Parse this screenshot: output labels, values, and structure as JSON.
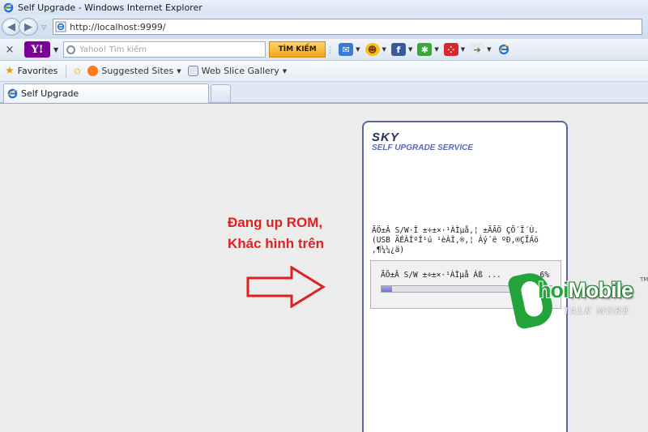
{
  "window": {
    "title": "Self Upgrade - Windows Internet Explorer"
  },
  "address_bar": {
    "url": "http://localhost:9999/"
  },
  "toolbar": {
    "search_placeholder": "Yahoo! Tìm kiếm",
    "search_button": "TÌM KIẾM",
    "yahoo_logo": "Y!"
  },
  "favorites_bar": {
    "favorites_label": "Favorites",
    "links": [
      {
        "label": "Suggested Sites"
      },
      {
        "label": "Web Slice Gallery"
      }
    ]
  },
  "tabs": [
    {
      "label": "Self Upgrade"
    }
  ],
  "annotation": {
    "line1": "Đang up ROM,",
    "line2": "Khác hình trên"
  },
  "upgrade_panel": {
    "brand": "SKY",
    "service": "SELF UPGRADE SERVICE",
    "message": "ÃÖ±Â S/W·Î ±÷±×·¹ÀÌµå,¦ ±ÃÃÖ ÇÕ´Ï´Ù.\n(USB ÄÉÀÌºÍ¹ú ¹èÀÌ,®,¦ Àý´ë ºÐ,®ÇÏÁö\n,¶¼¼¿ä)",
    "progress": {
      "label": "ÃÖ±Â S/W ±÷±×·¹ÀÌµå Áß ...",
      "percent_text": "6%",
      "percent": 6
    }
  },
  "watermark": {
    "brand_part1": "hoi",
    "brand_part2": "Mobile",
    "tagline": "TALK MORE",
    "trademark": "TM"
  },
  "colors": {
    "annotation": "#e02020",
    "panel_border": "#5a63a8",
    "progress_fill": "#7b7cd8"
  }
}
